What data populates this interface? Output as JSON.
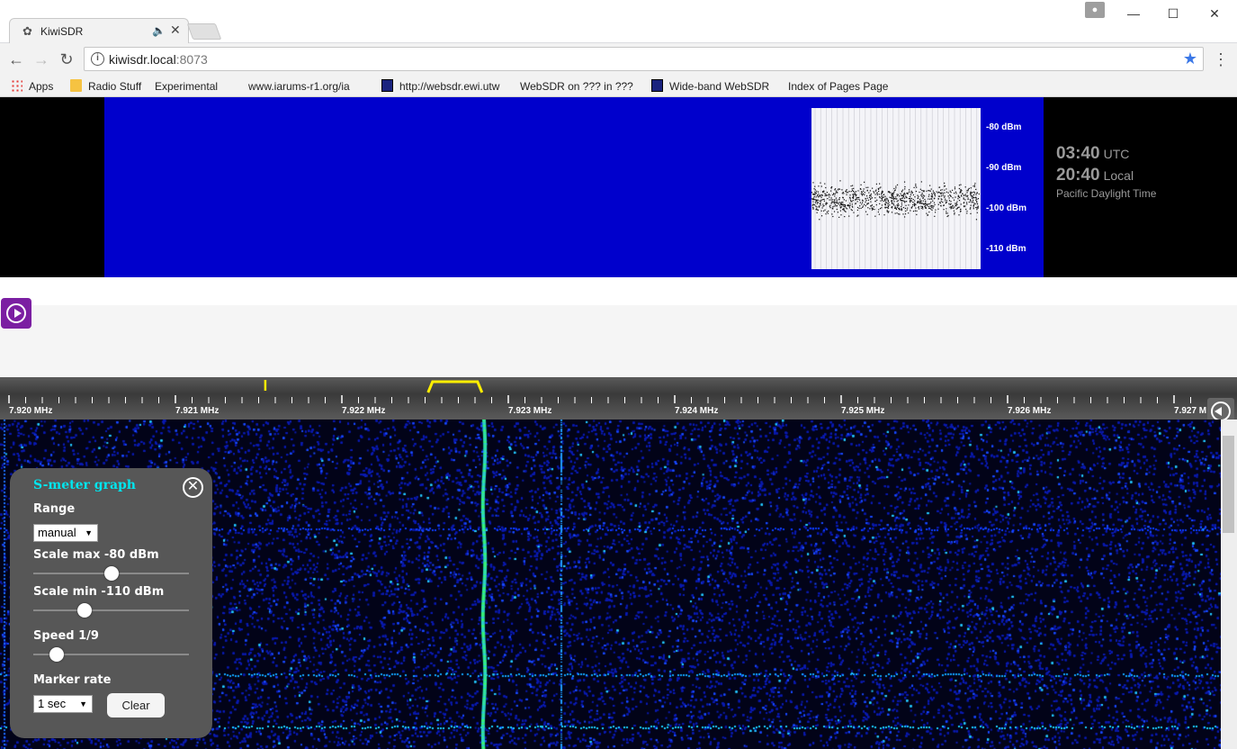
{
  "browser": {
    "tab_title": "KiwiSDR",
    "url_host": "kiwisdr.local",
    "url_port": ":8073",
    "bookmarks": [
      {
        "label": "Apps",
        "icon": "apps-icon"
      },
      {
        "label": "Radio Stuff",
        "icon": "folder-icon"
      },
      {
        "label": "Experimental",
        "icon": "page-icon"
      },
      {
        "label": "www.iarums-r1.org/ia",
        "icon": "page-icon"
      },
      {
        "label": "http://websdr.ewi.utw",
        "icon": "websdr-icon"
      },
      {
        "label": "WebSDR on ??? in ???",
        "icon": "page-icon"
      },
      {
        "label": "Wide-band WebSDR",
        "icon": "websdr-icon"
      },
      {
        "label": "Index of Pages Page",
        "icon": "page-icon"
      }
    ]
  },
  "smeter_graph": {
    "scale_labels": [
      "-80 dBm",
      "-90 dBm",
      "-100 dBm",
      "-110 dBm"
    ],
    "mean_level_dbm": -100
  },
  "clock": {
    "utc_time": "03:40",
    "utc_label": "UTC",
    "local_time": "20:40",
    "local_label": "Local",
    "timezone": "Pacific Daylight Time"
  },
  "frequency_scale": {
    "labels": [
      "7.920 MHz",
      "7.921 MHz",
      "7.922 MHz",
      "7.923 MHz",
      "7.924 MHz",
      "7.925 MHz",
      "7.926 MHz",
      "7.927 M"
    ],
    "start_mhz": 7.92,
    "end_mhz": 7.92715,
    "tuned_mhz": 7.92268,
    "marker_mhz": 7.92154
  },
  "smeter_panel": {
    "title": "S-meter graph",
    "range_label": "Range",
    "range_value": "manual",
    "scale_max_label": "Scale max -80 dBm",
    "scale_max_fraction": 0.5,
    "scale_min_label": "Scale min -110 dBm",
    "scale_min_fraction": 0.33,
    "speed_label": "Speed 1/9",
    "speed_fraction": 0.15,
    "marker_rate_label": "Marker rate",
    "marker_rate_value": "1 sec",
    "clear_label": "Clear"
  },
  "colors": {
    "spectrum_bg": "#0000cc",
    "panel_title": "#00e5ee",
    "passband": "#ffee00",
    "play_button": "#7b1fa2"
  }
}
